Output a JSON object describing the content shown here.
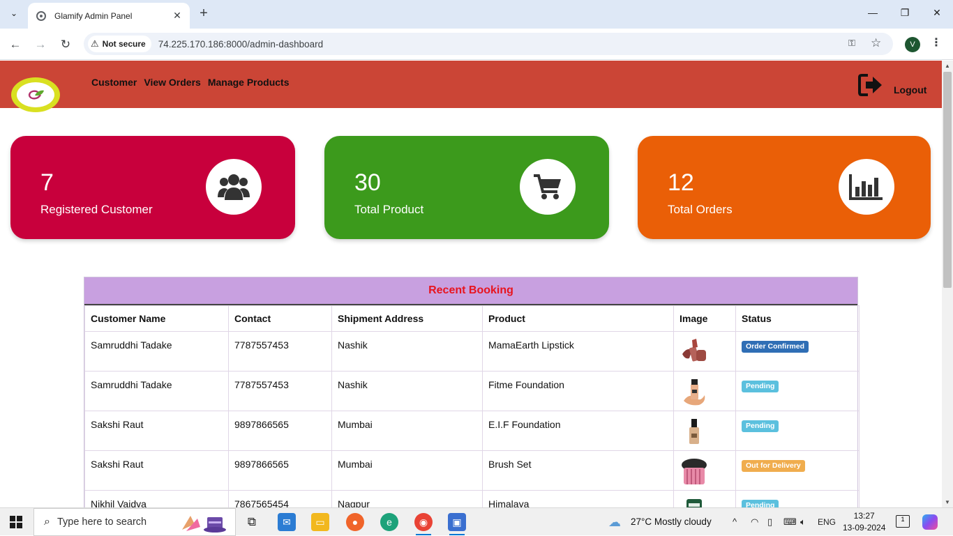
{
  "browser": {
    "tab_title": "Glamify Admin Panel",
    "security_label": "Not secure",
    "url": "74.225.170.186:8000/admin-dashboard",
    "profile_initial": "V"
  },
  "header": {
    "nav": [
      "Customer",
      "View Orders",
      "Manage Products"
    ],
    "logout_label": "Logout",
    "colors": {
      "header_bg": "#cb4536",
      "logo_ring": "#d9e021"
    }
  },
  "stats": [
    {
      "value": "7",
      "label": "Registered Customer",
      "icon": "users-icon",
      "color": "#c8003c"
    },
    {
      "value": "30",
      "label": "Total Product",
      "icon": "cart-icon",
      "color": "#3c9a1c"
    },
    {
      "value": "12",
      "label": "Total Orders",
      "icon": "bar-chart-icon",
      "color": "#ea5f07"
    }
  ],
  "recent_booking": {
    "title": "Recent Booking",
    "columns": [
      "Customer Name",
      "Contact",
      "Shipment Address",
      "Product",
      "Image",
      "Status"
    ],
    "rows": [
      {
        "name": "Samruddhi Tadake",
        "contact": "7787557453",
        "address": "Nashik",
        "product": "MamaEarth Lipstick",
        "image": "lipstick-image",
        "status": "Order Confirmed",
        "status_color": "#2f6eb5"
      },
      {
        "name": "Samruddhi Tadake",
        "contact": "7787557453",
        "address": "Nashik",
        "product": "Fitme Foundation",
        "image": "foundation-image",
        "status": "Pending",
        "status_color": "#5bc0de"
      },
      {
        "name": "Sakshi Raut",
        "contact": "9897866565",
        "address": "Mumbai",
        "product": "E.I.F Foundation",
        "image": "foundation-bottle-image",
        "status": "Pending",
        "status_color": "#5bc0de"
      },
      {
        "name": "Sakshi Raut",
        "contact": "9897866565",
        "address": "Mumbai",
        "product": "Brush Set",
        "image": "brush-set-image",
        "status": "Out for Delivery",
        "status_color": "#f0ad4e"
      },
      {
        "name": "Nikhil Vaidya",
        "contact": "7867565454",
        "address": "Nagpur",
        "product": "Himalaya",
        "image": "himalaya-image",
        "status": "Pending",
        "status_color": "#5bc0de"
      }
    ]
  },
  "taskbar": {
    "search_placeholder": "Type here to search",
    "weather": "27°C  Mostly cloudy",
    "language": "ENG",
    "time": "13:27",
    "date": "13-09-2024",
    "notification_count": "1"
  }
}
